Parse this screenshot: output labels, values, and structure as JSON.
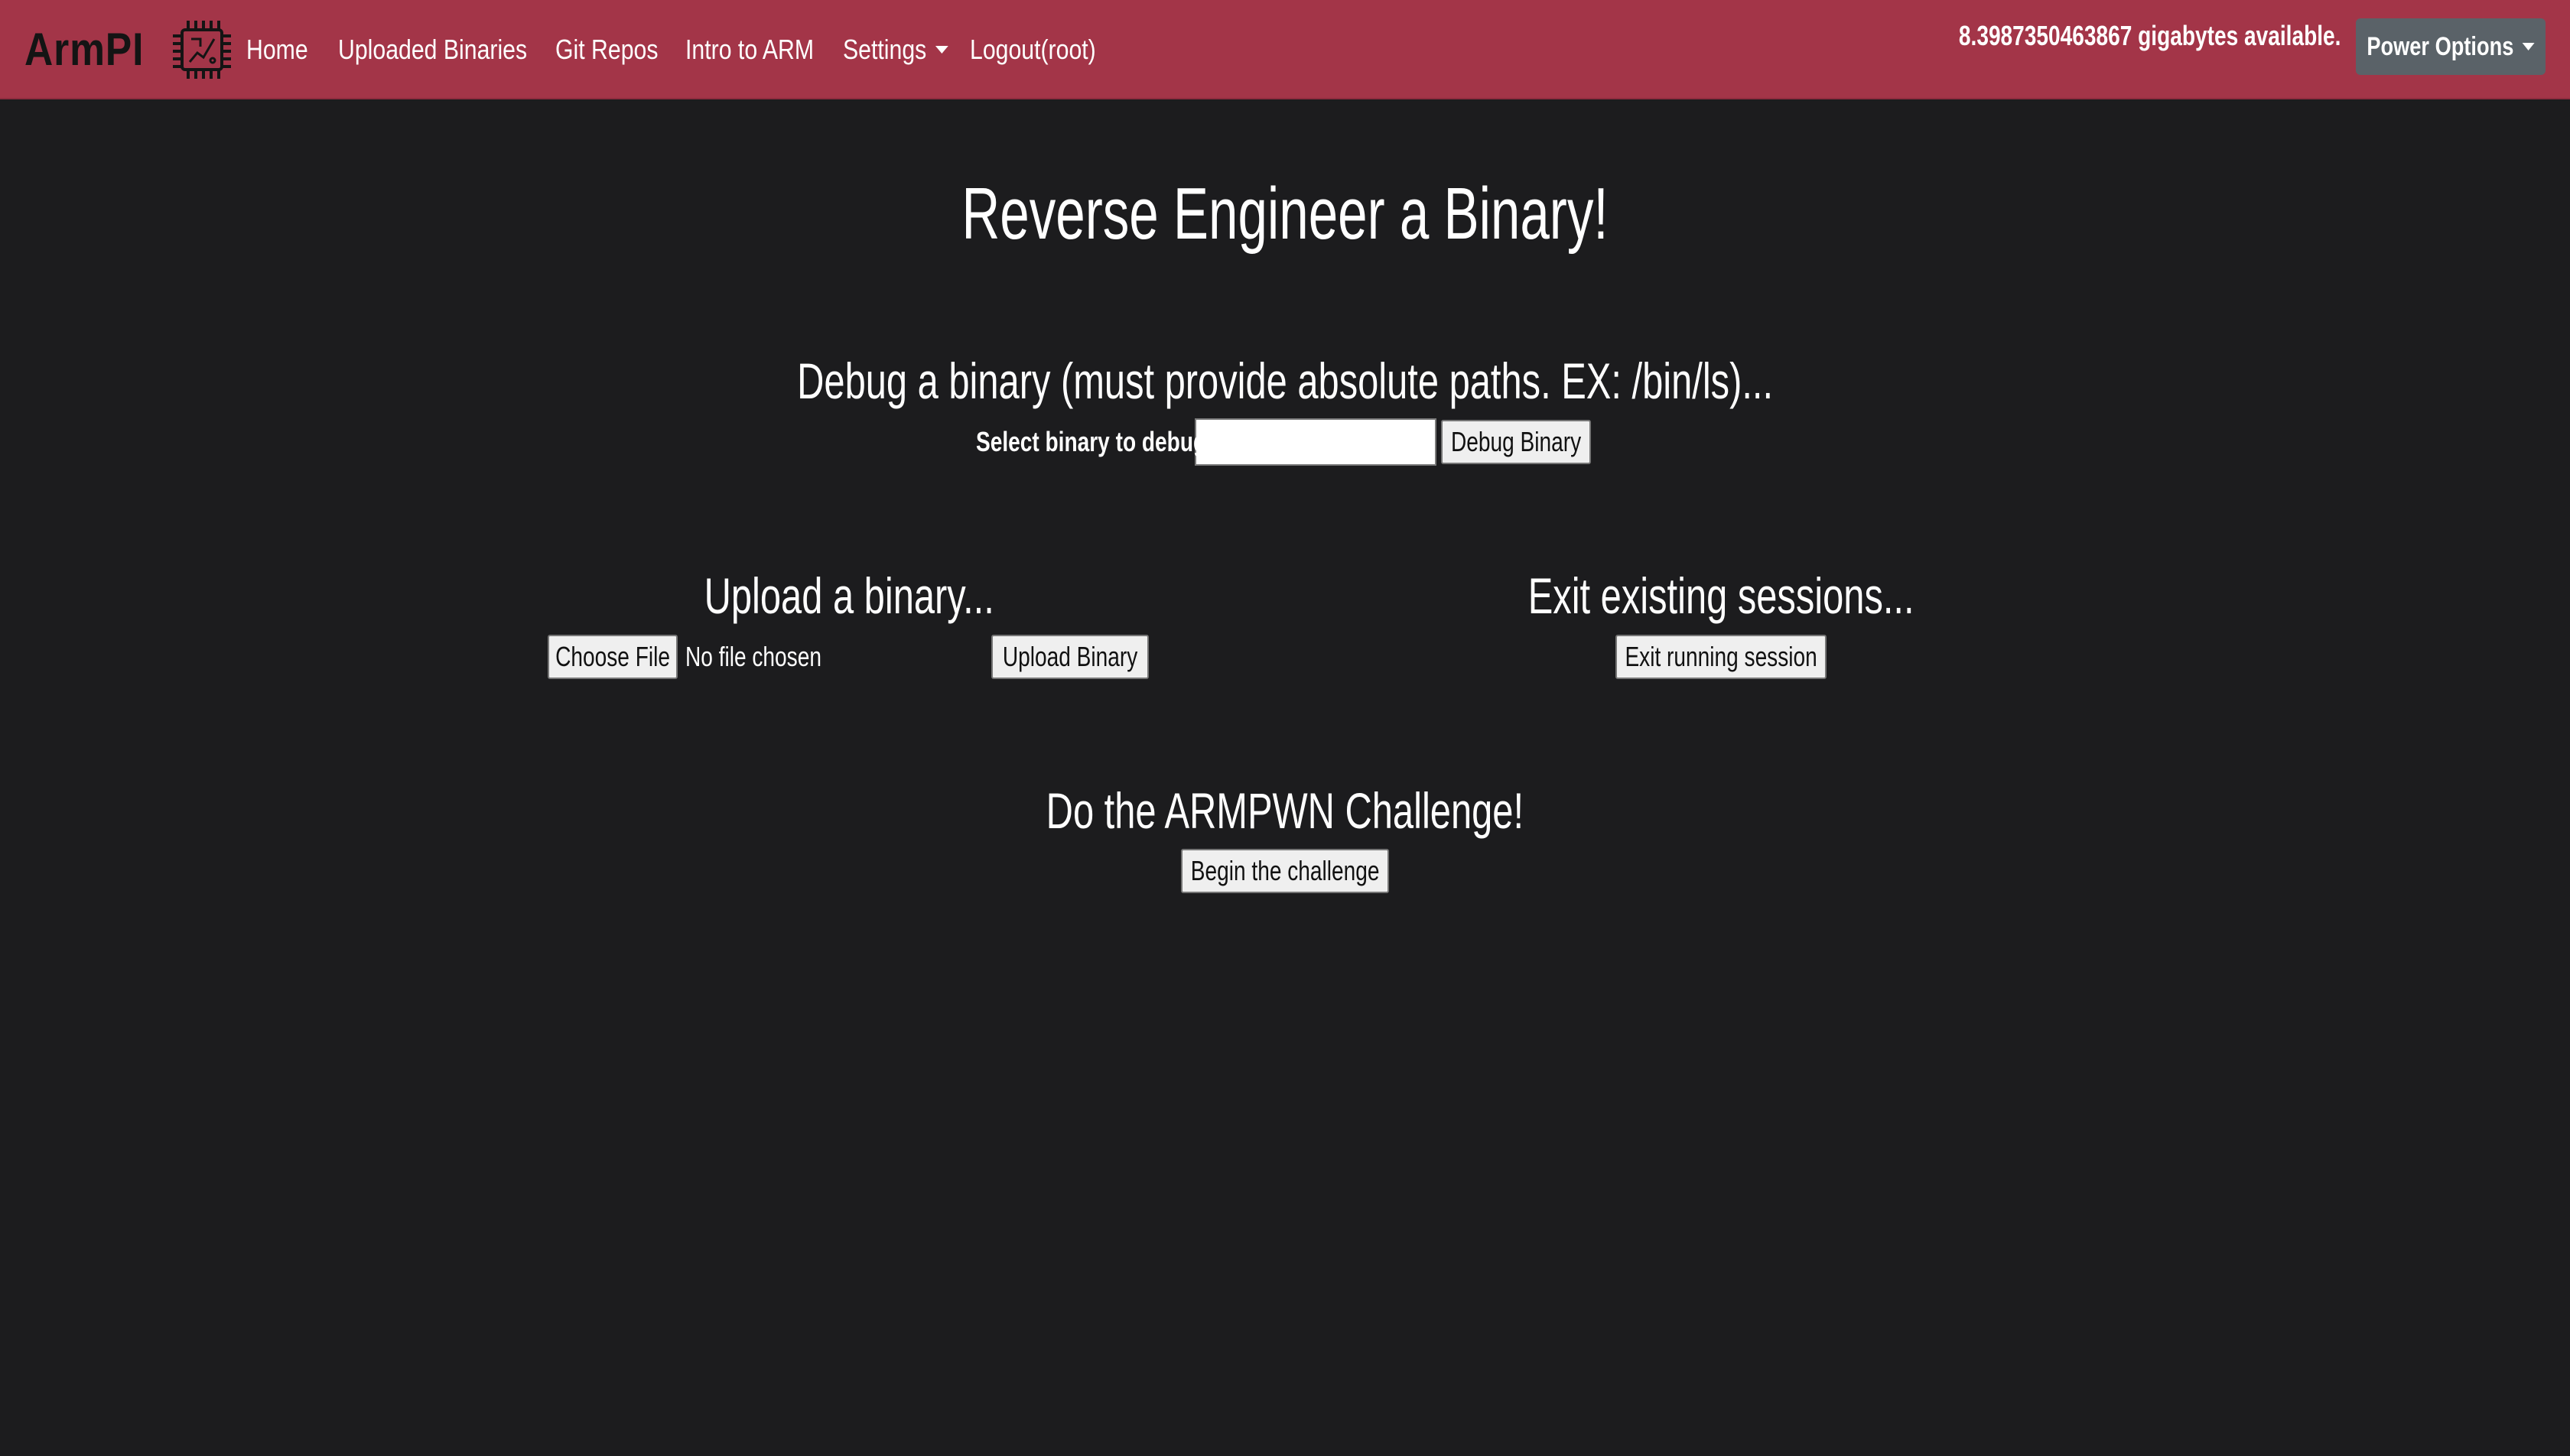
{
  "navbar": {
    "brand": "ArmPI",
    "links": [
      {
        "label": "Home"
      },
      {
        "label": "Uploaded Binaries"
      },
      {
        "label": "Git Repos"
      },
      {
        "label": "Intro to ARM"
      },
      {
        "label": "Settings"
      },
      {
        "label": "Logout(root)"
      }
    ],
    "storage_text": "8.3987350463867 gigabytes available.",
    "power_label": "Power Options",
    "background_color": "#a33548"
  },
  "main": {
    "title": "Reverse Engineer a Binary!",
    "debug": {
      "heading": "Debug a binary (must provide absolute paths. EX: /bin/ls)...",
      "label": "Select binary to debug:",
      "input_value": "",
      "button": "Debug Binary"
    },
    "upload": {
      "heading": "Upload a binary...",
      "choose_button": "Choose File",
      "file_status": "No file chosen",
      "button": "Upload Binary"
    },
    "exit": {
      "heading": "Exit existing sessions...",
      "button": "Exit running session"
    },
    "challenge": {
      "heading": "Do the ARMPWN Challenge!",
      "button": "Begin the challenge"
    },
    "background_color": "#1c1c1e"
  }
}
